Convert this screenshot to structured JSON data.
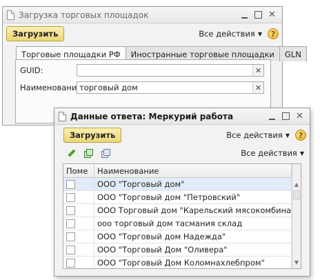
{
  "back_window": {
    "title": "Загрузка торговых площадок",
    "load_button": "Загрузить",
    "all_actions": "Все действия",
    "tabs": [
      {
        "label": "Торговые площадки РФ",
        "active": true
      },
      {
        "label": "Иностранные торговые площадки",
        "active": false
      },
      {
        "label": "GLN",
        "active": false
      }
    ],
    "guid_label": "GUID:",
    "guid_value": "",
    "name_label": "Наименование:",
    "name_value": "торговый дом"
  },
  "front_window": {
    "title": "Данные ответа: Меркурий работа",
    "load_button": "Загрузить",
    "all_actions": "Все действия",
    "toolbar_all_actions": "Все действия",
    "columns": [
      "Поме",
      "Наименование"
    ],
    "rows": [
      {
        "name": "ООО \"Торговый дом\"",
        "selected": true
      },
      {
        "name": "ООО \"Торговый дом \"Петровский\"",
        "selected": false
      },
      {
        "name": "ООО Торговый дом \"Карельский мясокомбинат\"",
        "selected": false
      },
      {
        "name": "ооо торговый дом тасмания склад",
        "selected": false
      },
      {
        "name": "ООО \"Торговый дом Надежда\"",
        "selected": false
      },
      {
        "name": "ООО \"Торговый Дом \"Оливера\"",
        "selected": false
      },
      {
        "name": "ООО \"Торговый Дом Коломнахлебпром\"",
        "selected": false
      }
    ]
  },
  "icons": [
    "doc-icon",
    "minimize-icon",
    "maximize-icon",
    "close-icon",
    "help-icon",
    "edit-icon",
    "check-all-icon",
    "uncheck-all-icon",
    "clear-icon"
  ],
  "colors": {
    "load_button": "#f3e08f",
    "selected_row": "#e2ecf8"
  }
}
